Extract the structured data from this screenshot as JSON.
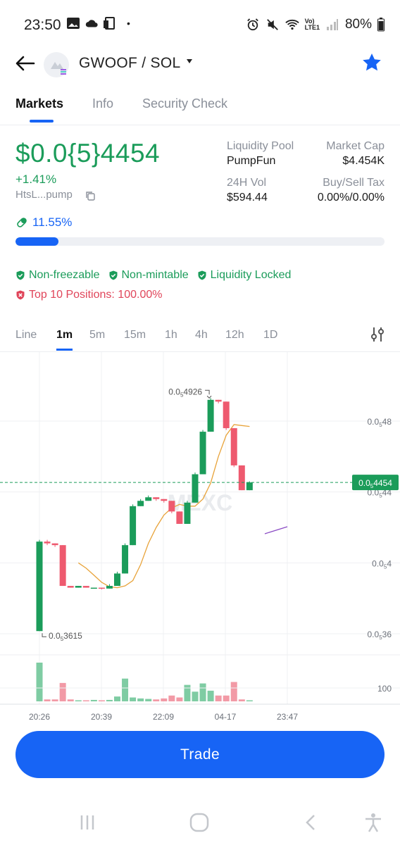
{
  "status": {
    "time": "23:50",
    "dot": "•",
    "battery": "80%",
    "network_label_top": "Vo)",
    "network_label_bottom": "LTE1"
  },
  "header": {
    "pair": "GWOOF / SOL"
  },
  "tabs": [
    {
      "label": "Markets"
    },
    {
      "label": "Info"
    },
    {
      "label": "Security Check"
    }
  ],
  "price": {
    "value": "$0.0{5}4454",
    "change": "+1.41%",
    "address": "HtsL...pump"
  },
  "stats": {
    "liquidity_pool_label": "Liquidity Pool",
    "liquidity_pool_value": "PumpFun",
    "market_cap_label": "Market Cap",
    "market_cap_value": "$4.454K",
    "vol_label": "24H Vol",
    "vol_value": "$594.44",
    "tax_label": "Buy/Sell Tax",
    "tax_value": "0.00%/0.00%"
  },
  "progress": {
    "label": "11.55%",
    "fraction": 0.1155
  },
  "badges": {
    "non_freezable": "Non-freezable",
    "non_mintable": "Non-mintable",
    "liquidity_locked": "Liquidity Locked",
    "top10": "Top 10 Positions: 100.00%"
  },
  "chart_tabs": [
    "Line",
    "1m",
    "5m",
    "15m",
    "1h",
    "4h",
    "12h",
    "1D"
  ],
  "colors": {
    "up": "#1b9c5a",
    "down": "#ee5a6f",
    "accent": "#1764f5",
    "ma": "#e8a33a",
    "ma2": "#8a4bc4"
  },
  "chart_data": {
    "type": "candlestick",
    "price_unit_note": "prices in units of 1e-5 SOL-quoted USD shown with subscript notation",
    "y_ticks": [
      {
        "value": 4.8,
        "label_main": "0.0",
        "label_sub": "5",
        "label_rest": "48"
      },
      {
        "value": 4.4,
        "label_main": "0.0",
        "label_sub": "5",
        "label_rest": "44"
      },
      {
        "value": 4.0,
        "label_main": "0.0",
        "label_sub": "5",
        "label_rest": "4"
      },
      {
        "value": 3.6,
        "label_main": "0.0",
        "label_sub": "5",
        "label_rest": "36"
      }
    ],
    "ylim": [
      3.5,
      5.0
    ],
    "x_ticks": [
      "20:26",
      "20:39",
      "22:09",
      "04-17",
      "23:47"
    ],
    "current_price": {
      "value": 4.454,
      "label_main": "0.0",
      "label_sub": "5",
      "label_rest": "4454"
    },
    "high_label": {
      "value": 4.926,
      "label_main": "0.0",
      "label_sub": "5",
      "label_rest": "4926"
    },
    "low_label": {
      "value": 3.615,
      "label_main": "0.0",
      "label_sub": "5",
      "label_rest": "3615"
    },
    "watermark": "MEXC",
    "candles": [
      {
        "o": 3.615,
        "h": 4.13,
        "l": 3.615,
        "c": 4.12,
        "v": 80
      },
      {
        "o": 4.12,
        "h": 4.13,
        "l": 4.1,
        "c": 4.11,
        "v": 4
      },
      {
        "o": 4.11,
        "h": 4.11,
        "l": 4.09,
        "c": 4.1,
        "v": 4
      },
      {
        "o": 4.1,
        "h": 4.1,
        "l": 3.87,
        "c": 3.87,
        "v": 38
      },
      {
        "o": 3.87,
        "h": 3.87,
        "l": 3.86,
        "c": 3.86,
        "v": 4
      },
      {
        "o": 3.86,
        "h": 3.87,
        "l": 3.86,
        "c": 3.87,
        "v": 2
      },
      {
        "o": 3.87,
        "h": 3.87,
        "l": 3.86,
        "c": 3.86,
        "v": 2
      },
      {
        "o": 3.86,
        "h": 3.86,
        "l": 3.86,
        "c": 3.86,
        "v": 3
      },
      {
        "o": 3.86,
        "h": 3.86,
        "l": 3.85,
        "c": 3.855,
        "v": 2
      },
      {
        "o": 3.855,
        "h": 3.88,
        "l": 3.855,
        "c": 3.87,
        "v": 3
      },
      {
        "o": 3.87,
        "h": 3.95,
        "l": 3.87,
        "c": 3.94,
        "v": 10
      },
      {
        "o": 3.94,
        "h": 4.11,
        "l": 3.94,
        "c": 4.1,
        "v": 47
      },
      {
        "o": 4.1,
        "h": 4.33,
        "l": 4.1,
        "c": 4.32,
        "v": 8
      },
      {
        "o": 4.32,
        "h": 4.36,
        "l": 4.32,
        "c": 4.35,
        "v": 6
      },
      {
        "o": 4.35,
        "h": 4.38,
        "l": 4.35,
        "c": 4.37,
        "v": 5
      },
      {
        "o": 4.37,
        "h": 4.37,
        "l": 4.35,
        "c": 4.36,
        "v": 4
      },
      {
        "o": 4.36,
        "h": 4.36,
        "l": 4.34,
        "c": 4.35,
        "v": 6
      },
      {
        "o": 4.35,
        "h": 4.35,
        "l": 4.28,
        "c": 4.29,
        "v": 12
      },
      {
        "o": 4.29,
        "h": 4.29,
        "l": 4.22,
        "c": 4.22,
        "v": 8
      },
      {
        "o": 4.22,
        "h": 4.35,
        "l": 4.22,
        "c": 4.34,
        "v": 34
      },
      {
        "o": 4.34,
        "h": 4.51,
        "l": 4.34,
        "c": 4.5,
        "v": 20
      },
      {
        "o": 4.5,
        "h": 4.75,
        "l": 4.5,
        "c": 4.74,
        "v": 37
      },
      {
        "o": 4.74,
        "h": 4.93,
        "l": 4.74,
        "c": 4.92,
        "v": 22
      },
      {
        "o": 4.92,
        "h": 4.92,
        "l": 4.9,
        "c": 4.91,
        "v": 12
      },
      {
        "o": 4.91,
        "h": 4.91,
        "l": 4.75,
        "c": 4.76,
        "v": 12
      },
      {
        "o": 4.76,
        "h": 4.76,
        "l": 4.54,
        "c": 4.55,
        "v": 40
      },
      {
        "o": 4.55,
        "h": 4.55,
        "l": 4.41,
        "c": 4.41,
        "v": 4
      },
      {
        "o": 4.41,
        "h": 4.46,
        "l": 4.41,
        "c": 4.454,
        "v": 2
      }
    ],
    "ma1": [
      null,
      null,
      null,
      null,
      4.0,
      3.97,
      3.93,
      3.89,
      3.865,
      3.86,
      3.87,
      3.9,
      3.99,
      4.11,
      4.2,
      4.27,
      4.31,
      4.33,
      4.32,
      4.32,
      4.36,
      4.45,
      4.6,
      4.72,
      4.78,
      4.775,
      4.77
    ],
    "ma2": [
      4.15,
      4.2
    ],
    "volume_tick": "100",
    "volume_tick_value": 100
  },
  "trade_button": "Trade"
}
